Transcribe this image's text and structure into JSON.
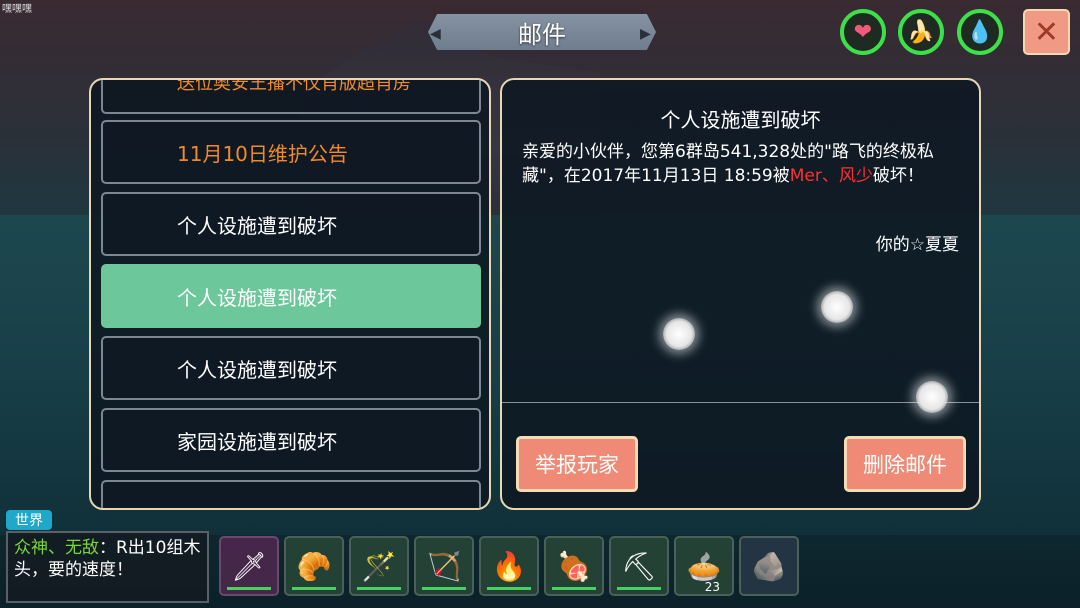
{
  "corner_text": "嘿嘿嘿",
  "window": {
    "title": "邮件"
  },
  "status_icons": [
    {
      "name": "heart-icon",
      "glyph": "❤",
      "color": "#f25a7a"
    },
    {
      "name": "food-icon",
      "glyph": "🍌",
      "color": "#e8d040"
    },
    {
      "name": "water-icon",
      "glyph": "💧",
      "color": "#38c0e0"
    }
  ],
  "close_label": "✕",
  "mail_list": [
    {
      "title": "送位奥安王播不仪肖版超肖房",
      "type": "partial"
    },
    {
      "title": "11月10日维护公告",
      "type": "notice"
    },
    {
      "title": "个人设施遭到破坏",
      "type": "normal"
    },
    {
      "title": "个人设施遭到破坏",
      "type": "selected"
    },
    {
      "title": "个人设施遭到破坏",
      "type": "normal"
    },
    {
      "title": "家园设施遭到破坏",
      "type": "normal"
    }
  ],
  "detail": {
    "title": "个人设施遭到破坏",
    "body_before": "亲爱的小伙伴，您第6群岛541,328处的\"路飞的终极私藏\"，在2017年11月13日 18:59被",
    "attackers": "Mer、风少",
    "body_after": "破坏！",
    "signature": "你的☆夏夏"
  },
  "buttons": {
    "report": "举报玩家",
    "delete": "删除邮件"
  },
  "chat": {
    "channel": "世界",
    "speaker": "众神、无敌",
    "message": "：R出10组木头，要的速度！"
  },
  "hotbar": [
    {
      "name": "scythe-icon",
      "glyph": "🗡",
      "count": ""
    },
    {
      "name": "horn-icon",
      "glyph": "🥐",
      "count": ""
    },
    {
      "name": "staff-icon",
      "glyph": "🪄",
      "count": ""
    },
    {
      "name": "bow-icon",
      "glyph": "🏹",
      "count": ""
    },
    {
      "name": "campfire-icon",
      "glyph": "🔥",
      "count": ""
    },
    {
      "name": "meat-icon",
      "glyph": "🍖",
      "count": ""
    },
    {
      "name": "pickaxe-icon",
      "glyph": "⛏",
      "count": ""
    },
    {
      "name": "pie-icon",
      "glyph": "🥧",
      "count": "23"
    },
    {
      "name": "stone-icon",
      "glyph": "🪨",
      "count": ""
    }
  ]
}
